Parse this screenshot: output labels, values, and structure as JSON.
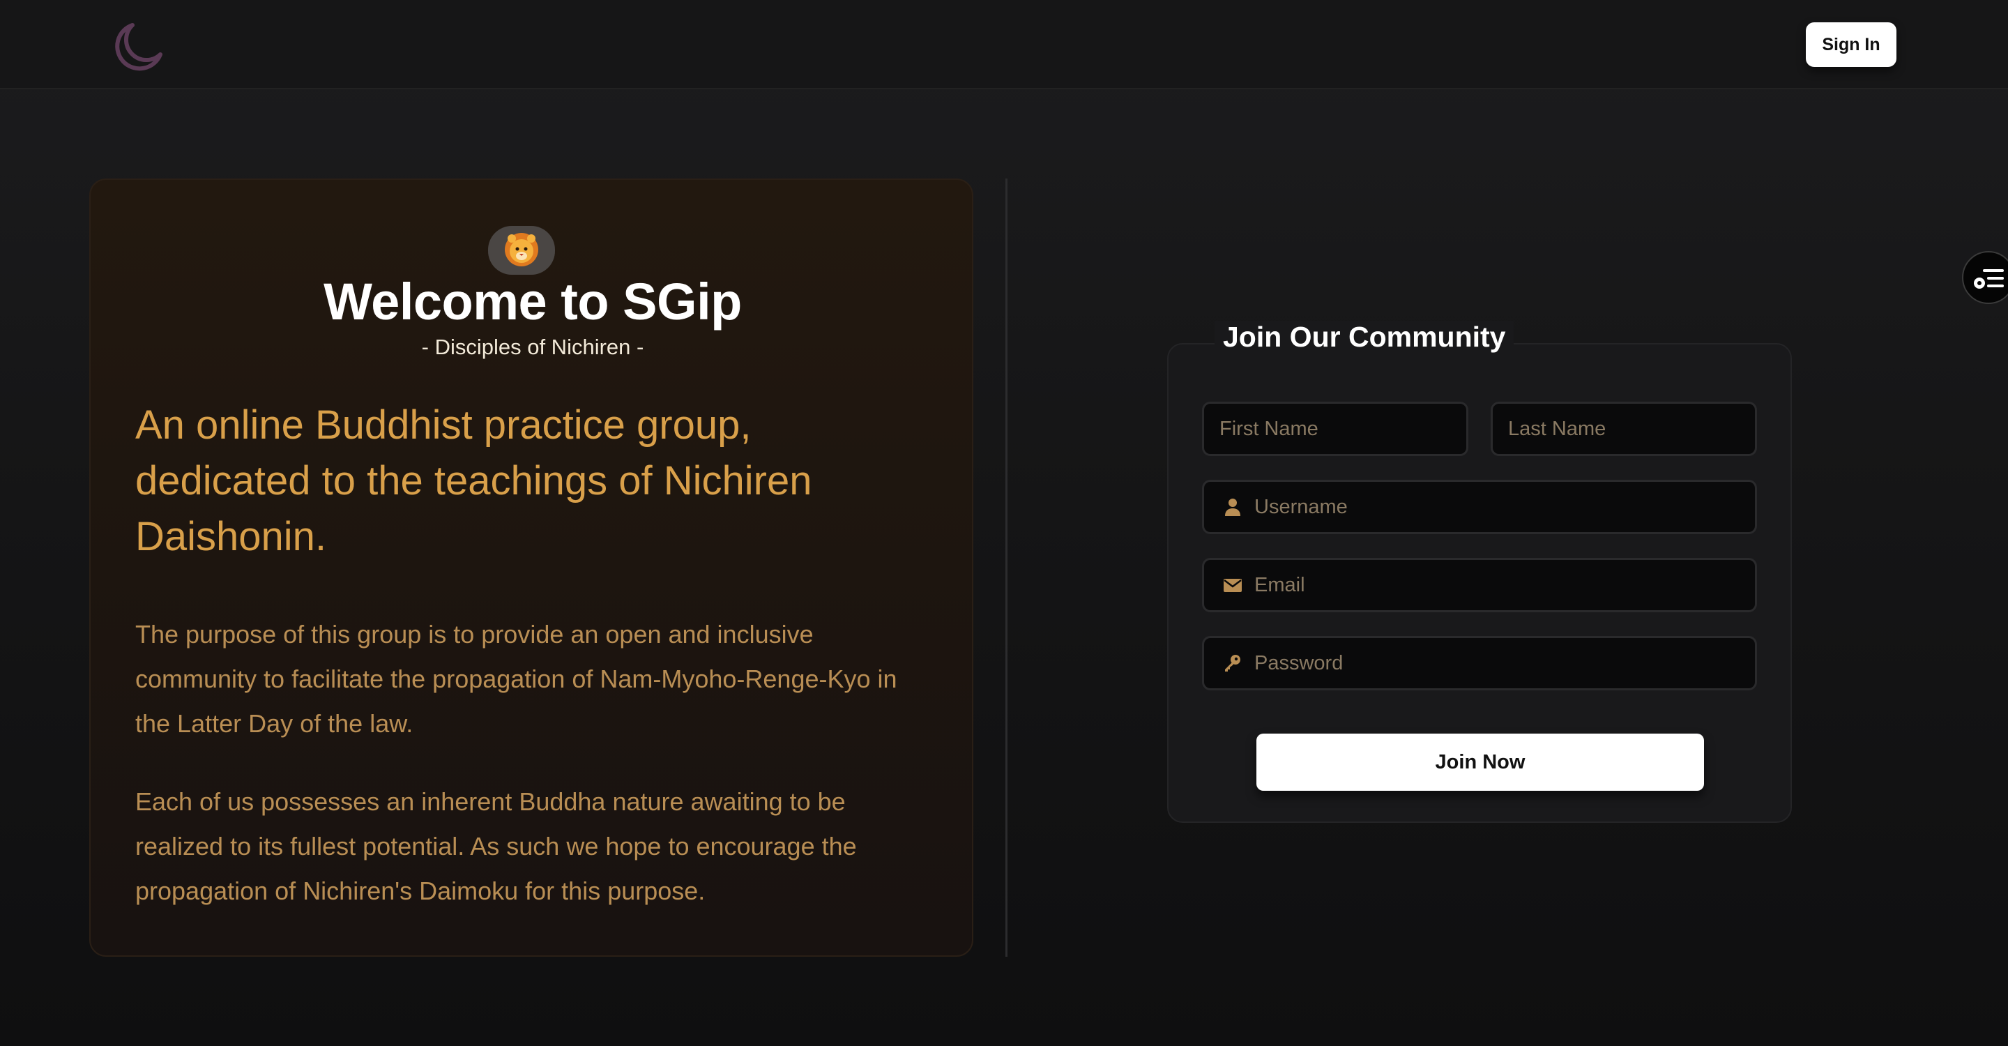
{
  "header": {
    "logo_icon": "crescent-moon-icon",
    "sign_in_label": "Sign In"
  },
  "side_toggle": {
    "icon": "settings-list-icon"
  },
  "info_card": {
    "badge_icon": "lion-face-icon",
    "title": "Welcome to SGip",
    "subtitle": "- Disciples of Nichiren -",
    "tagline": "An online Buddhist practice group, dedicated to the teachings of Nichiren Daishonin.",
    "paragraphs": [
      "The purpose of this group is to provide an open and inclusive community to facilitate the propagation of Nam-Myoho-Renge-Kyo in the Latter Day of the law.",
      "Each of us possesses an inherent Buddha nature awaiting to be realized to its fullest potential. As such we hope to encourage the propagation of Nichiren's Daimoku for this purpose."
    ]
  },
  "signup_form": {
    "title": "Join Our Community",
    "first_name": {
      "placeholder": "First Name",
      "value": ""
    },
    "last_name": {
      "placeholder": "Last Name",
      "value": ""
    },
    "username": {
      "placeholder": "Username",
      "value": "",
      "icon": "user-icon"
    },
    "email": {
      "placeholder": "Email",
      "value": "",
      "icon": "envelope-icon"
    },
    "password": {
      "placeholder": "Password",
      "value": "",
      "icon": "key-icon"
    },
    "submit_label": "Join Now"
  },
  "colors": {
    "accent_gold": "#d9a04a",
    "body_gold": "#b98e54",
    "logo_purple": "#5a3a55",
    "background": "#161617"
  }
}
